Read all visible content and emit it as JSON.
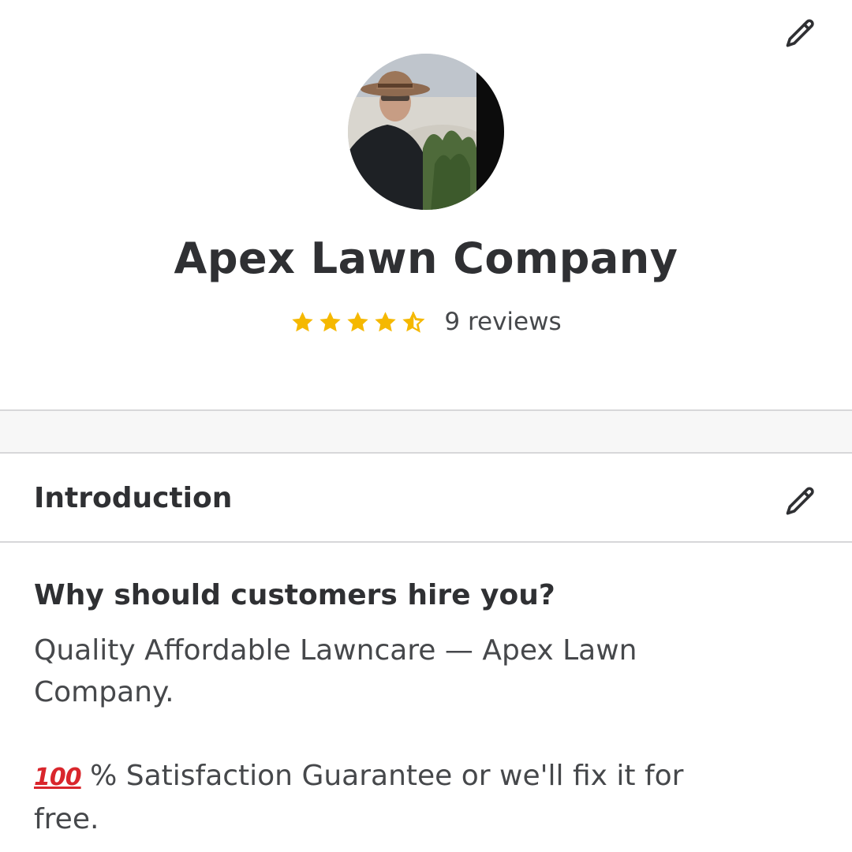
{
  "profile": {
    "avatar_icon": "profile-photo",
    "business_name": "Apex Lawn Company",
    "rating": 4.5,
    "rating_max": 5,
    "star_color": "#f5b800",
    "reviews_label": "9 reviews"
  },
  "introduction": {
    "title": "Introduction",
    "edit_icon": "pencil-icon",
    "question": "Why should customers hire you?",
    "answer_line1": "Quality Affordable Lawncare — Apex Lawn Company.",
    "guarantee_emoji": "100",
    "guarantee_text": "% Satisfaction Guarantee or we'll fix it for free."
  },
  "colors": {
    "text_primary": "#2f3033",
    "text_secondary": "#46484b",
    "divider": "#d7d7d9"
  }
}
